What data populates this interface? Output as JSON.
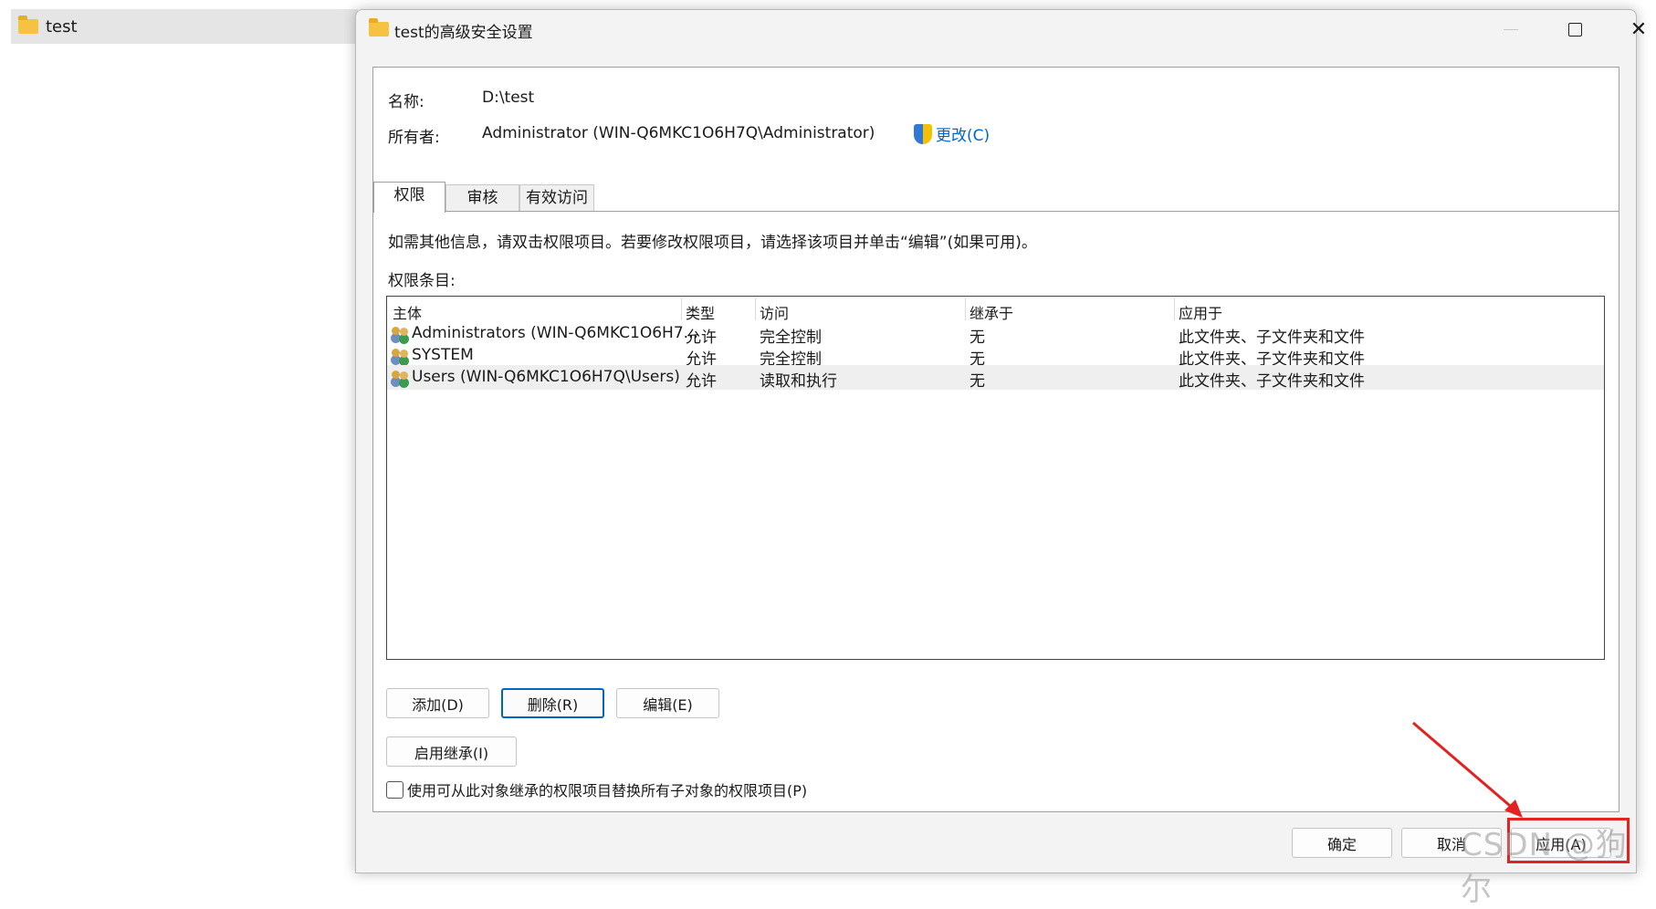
{
  "explorer": {
    "item_label": "test"
  },
  "window": {
    "title": "test的高级安全设置",
    "minimize_icon": "minimize-icon",
    "maximize_icon": "maximize-icon",
    "close_icon": "close-icon"
  },
  "info": {
    "name_label": "名称:",
    "name_value": "D:\\test",
    "owner_label": "所有者:",
    "owner_value": "Administrator (WIN-Q6MKC1O6H7Q\\Administrator)",
    "change_link": "更改(C)"
  },
  "tabs": [
    {
      "label": "权限",
      "active": true
    },
    {
      "label": "审核",
      "active": false
    },
    {
      "label": "有效访问",
      "active": false
    }
  ],
  "permissions": {
    "instruction": "如需其他信息，请双击权限项目。若要修改权限项目，请选择该项目并单击“编辑”(如果可用)。",
    "entries_label": "权限条目:",
    "columns": [
      "主体",
      "类型",
      "访问",
      "继承于",
      "应用于"
    ],
    "rows": [
      {
        "principal": "Administrators (WIN-Q6MKC1O6H7...",
        "type": "允许",
        "access": "完全控制",
        "inherited_from": "无",
        "applies_to": "此文件夹、子文件夹和文件",
        "selected": false
      },
      {
        "principal": "SYSTEM",
        "type": "允许",
        "access": "完全控制",
        "inherited_from": "无",
        "applies_to": "此文件夹、子文件夹和文件",
        "selected": false
      },
      {
        "principal": "Users (WIN-Q6MKC1O6H7Q\\Users)",
        "type": "允许",
        "access": "读取和执行",
        "inherited_from": "无",
        "applies_to": "此文件夹、子文件夹和文件",
        "selected": true
      }
    ]
  },
  "buttons": {
    "add": "添加(D)",
    "remove": "删除(R)",
    "edit": "编辑(E)",
    "enable_inheritance": "启用继承(I)",
    "ok": "确定",
    "cancel": "取消",
    "apply": "应用(A)"
  },
  "checkbox": {
    "label": "使用可从此对象继承的权限项目替换所有子对象的权限项目(P)",
    "checked": false
  },
  "watermark": "CSDN @狗尔"
}
